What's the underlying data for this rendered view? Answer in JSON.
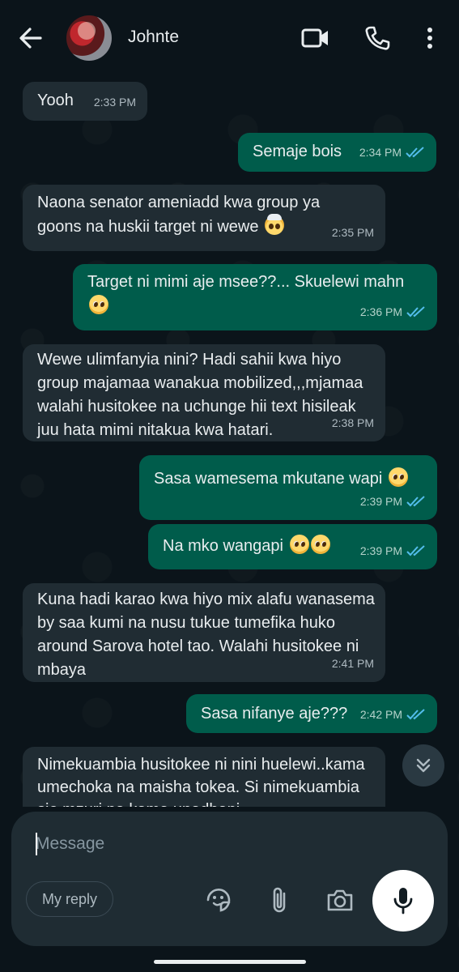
{
  "header": {
    "contact_name": "Johnte",
    "back_icon": "arrow-left-icon",
    "video_icon": "video-call-icon",
    "call_icon": "phone-icon",
    "menu_icon": "more-vertical-icon"
  },
  "messages": [
    {
      "dir": "in",
      "text": "Yooh",
      "time": "2:33 PM"
    },
    {
      "dir": "out",
      "text": "Semaje bois",
      "time": "2:34 PM",
      "read": true
    },
    {
      "dir": "in",
      "text": "Naona senator ameniadd kwa group ya goons na huskii target ni wewe",
      "emoji": "exploding-head",
      "time": "2:35 PM"
    },
    {
      "dir": "out",
      "text": "Target ni mimi aje msee??... Skuelewi mahn",
      "emoji": "pleading-face",
      "time": "2:36 PM",
      "read": true
    },
    {
      "dir": "in",
      "text": "Wewe ulimfanyia nini? Hadi sahii kwa hiyo group majamaa wanakua mobilized,,,mjamaa walahi husitokee na uchunge hii text hisileak juu hata mimi nitakua kwa hatari.",
      "time": "2:38 PM"
    },
    {
      "dir": "out",
      "text": "Sasa wamesema mkutane wapi",
      "emoji": "pleading-face",
      "time": "2:39 PM",
      "read": true
    },
    {
      "dir": "out",
      "text": "Na mko wangapi",
      "emoji": "pleading-face x2",
      "time": "2:39 PM",
      "read": true
    },
    {
      "dir": "in",
      "text": "Kuna hadi karao kwa hiyo mix alafu wanasema by saa kumi na nusu tukue tumefika huko around Sarova hotel tao. Walahi husitokee ni mbaya",
      "time": "2:41 PM"
    },
    {
      "dir": "out",
      "text": "Sasa nifanye aje???",
      "time": "2:42 PM",
      "read": true
    },
    {
      "dir": "in",
      "text": "Nimekuambia husitokee ni nini huelewi..kama umechoka na maisha tokea. Si nimekuambia sio mzuri na kama unadhani",
      "time": ""
    }
  ],
  "composer": {
    "placeholder": "Message",
    "reply_chip": "My reply",
    "sticker_icon": "sticker-icon",
    "attach_icon": "paperclip-icon",
    "camera_icon": "camera-icon",
    "mic_icon": "microphone-icon",
    "scroll_icon": "double-chevron-down-icon"
  },
  "colors": {
    "background": "#0b141a",
    "incoming_bubble": "#202c33",
    "outgoing_bubble": "#005c4b",
    "read_ticks": "#53bdeb"
  }
}
